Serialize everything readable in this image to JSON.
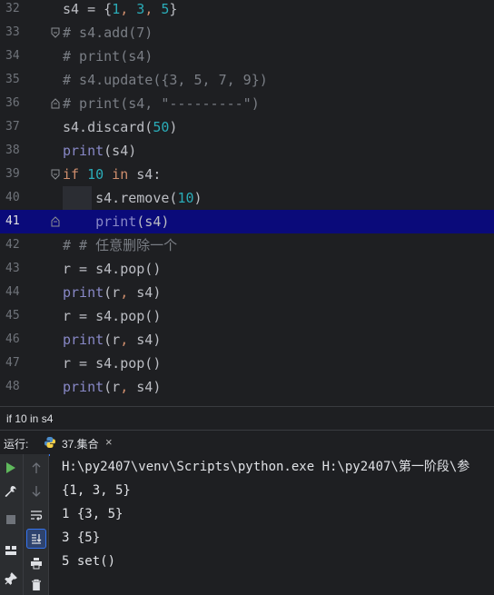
{
  "editor": {
    "lines": [
      {
        "num": "32",
        "tokens": [
          {
            "t": "s4 = {",
            "c": ""
          },
          {
            "t": "1",
            "c": "num"
          },
          {
            "t": ", ",
            "c": "comma"
          },
          {
            "t": "3",
            "c": "num"
          },
          {
            "t": ", ",
            "c": "comma"
          },
          {
            "t": "5",
            "c": "num"
          },
          {
            "t": "}",
            "c": ""
          }
        ]
      },
      {
        "num": "33",
        "tokens": [
          {
            "t": "# s4.add(7)",
            "c": "cm"
          }
        ]
      },
      {
        "num": "34",
        "tokens": [
          {
            "t": "# print(s4)",
            "c": "cm"
          }
        ]
      },
      {
        "num": "35",
        "tokens": [
          {
            "t": "# s4.update({3, 5, 7, 9})",
            "c": "cm"
          }
        ]
      },
      {
        "num": "36",
        "tokens": [
          {
            "t": "# print(s4, \"---------\")",
            "c": "cm"
          }
        ]
      },
      {
        "num": "37",
        "tokens": [
          {
            "t": "s4.discard(",
            "c": ""
          },
          {
            "t": "50",
            "c": "num"
          },
          {
            "t": ")",
            "c": ""
          }
        ]
      },
      {
        "num": "38",
        "tokens": [
          {
            "t": "print",
            "c": "bi"
          },
          {
            "t": "(s4)",
            "c": ""
          }
        ]
      },
      {
        "num": "39",
        "tokens": [
          {
            "t": "if ",
            "c": "kw"
          },
          {
            "t": "10",
            "c": "num"
          },
          {
            "t": " in ",
            "c": "kw"
          },
          {
            "t": "s4:",
            "c": ""
          }
        ]
      },
      {
        "num": "40",
        "tokens": [
          {
            "t": "    s4.remove(",
            "c": ""
          },
          {
            "t": "10",
            "c": "num"
          },
          {
            "t": ")",
            "c": ""
          }
        ]
      },
      {
        "num": "41",
        "tokens": [
          {
            "t": "    ",
            "c": ""
          },
          {
            "t": "print",
            "c": "bi"
          },
          {
            "t": "(s4)",
            "c": ""
          }
        ]
      },
      {
        "num": "42",
        "tokens": [
          {
            "t": "# # 任意删除一个",
            "c": "cm"
          }
        ]
      },
      {
        "num": "43",
        "tokens": [
          {
            "t": "r = s4.pop()",
            "c": ""
          }
        ]
      },
      {
        "num": "44",
        "tokens": [
          {
            "t": "print",
            "c": "bi"
          },
          {
            "t": "(r",
            "c": ""
          },
          {
            "t": ", ",
            "c": "comma"
          },
          {
            "t": "s4)",
            "c": ""
          }
        ]
      },
      {
        "num": "45",
        "tokens": [
          {
            "t": "r = s4.pop()",
            "c": ""
          }
        ]
      },
      {
        "num": "46",
        "tokens": [
          {
            "t": "print",
            "c": "bi"
          },
          {
            "t": "(r",
            "c": ""
          },
          {
            "t": ", ",
            "c": "comma"
          },
          {
            "t": "s4)",
            "c": ""
          }
        ]
      },
      {
        "num": "47",
        "tokens": [
          {
            "t": "r = s4.pop()",
            "c": ""
          }
        ]
      },
      {
        "num": "48",
        "tokens": [
          {
            "t": "print",
            "c": "bi"
          },
          {
            "t": "(r",
            "c": ""
          },
          {
            "t": ", ",
            "c": "comma"
          },
          {
            "t": "s4)",
            "c": ""
          }
        ]
      }
    ],
    "current_line": "41"
  },
  "breadcrumb": "if 10 in s4",
  "run_panel": {
    "label": "运行:",
    "tab_label": "37.集合",
    "close": "×"
  },
  "console": {
    "lines": [
      "H:\\py2407\\venv\\Scripts\\python.exe H:\\py2407\\第一阶段\\参",
      "{1, 3, 5}",
      "1 {3, 5}",
      "3 {5}",
      "5 set()"
    ]
  },
  "icons": {
    "run": "play-icon",
    "rerun": "wrench-icon",
    "stop": "stop-icon",
    "layout": "layout-icon",
    "pin": "pin-icon",
    "up": "arrow-up-icon",
    "down": "arrow-down-icon",
    "wrap": "soft-wrap-icon",
    "scroll": "scroll-to-end-icon",
    "print": "print-icon",
    "trash": "trash-icon"
  }
}
